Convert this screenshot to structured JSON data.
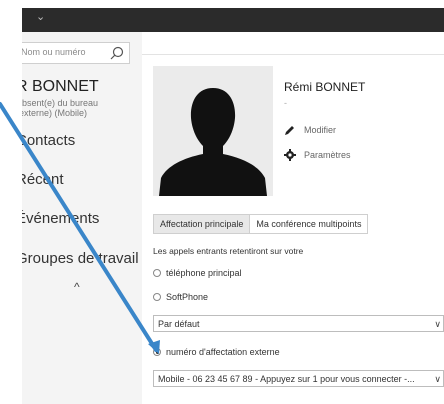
{
  "window": {
    "menu_chevron": "⌄"
  },
  "sidebar": {
    "search_placeholder": "Nom ou numéro",
    "user_name": "R BONNET",
    "user_status_line1": "Absent(e) du bureau",
    "user_status_line2": "(externe) (Mobile)",
    "nav": [
      "Contacts",
      "Récent",
      "Événements",
      "Groupes de travail"
    ],
    "collapse_chevron": "^"
  },
  "profile": {
    "name": "Rémi BONNET",
    "subline": "-",
    "edit_label": "Modifier",
    "settings_label": "Paramètres"
  },
  "tabs": [
    "Affectation principale",
    "Ma conférence multipoints"
  ],
  "routing": {
    "info": "Les appels entrants retentiront sur votre",
    "options": [
      "téléphone principal",
      "SoftPhone",
      "numéro d'affectation externe"
    ],
    "softphone_select": "Par défaut",
    "external_select": "Mobile - 06 23 45 67 89 - Appuyez sur 1 pour vous connecter -..."
  },
  "colors": {
    "accent_arrow": "#3a86c9",
    "topbar": "#2b2b2b"
  }
}
